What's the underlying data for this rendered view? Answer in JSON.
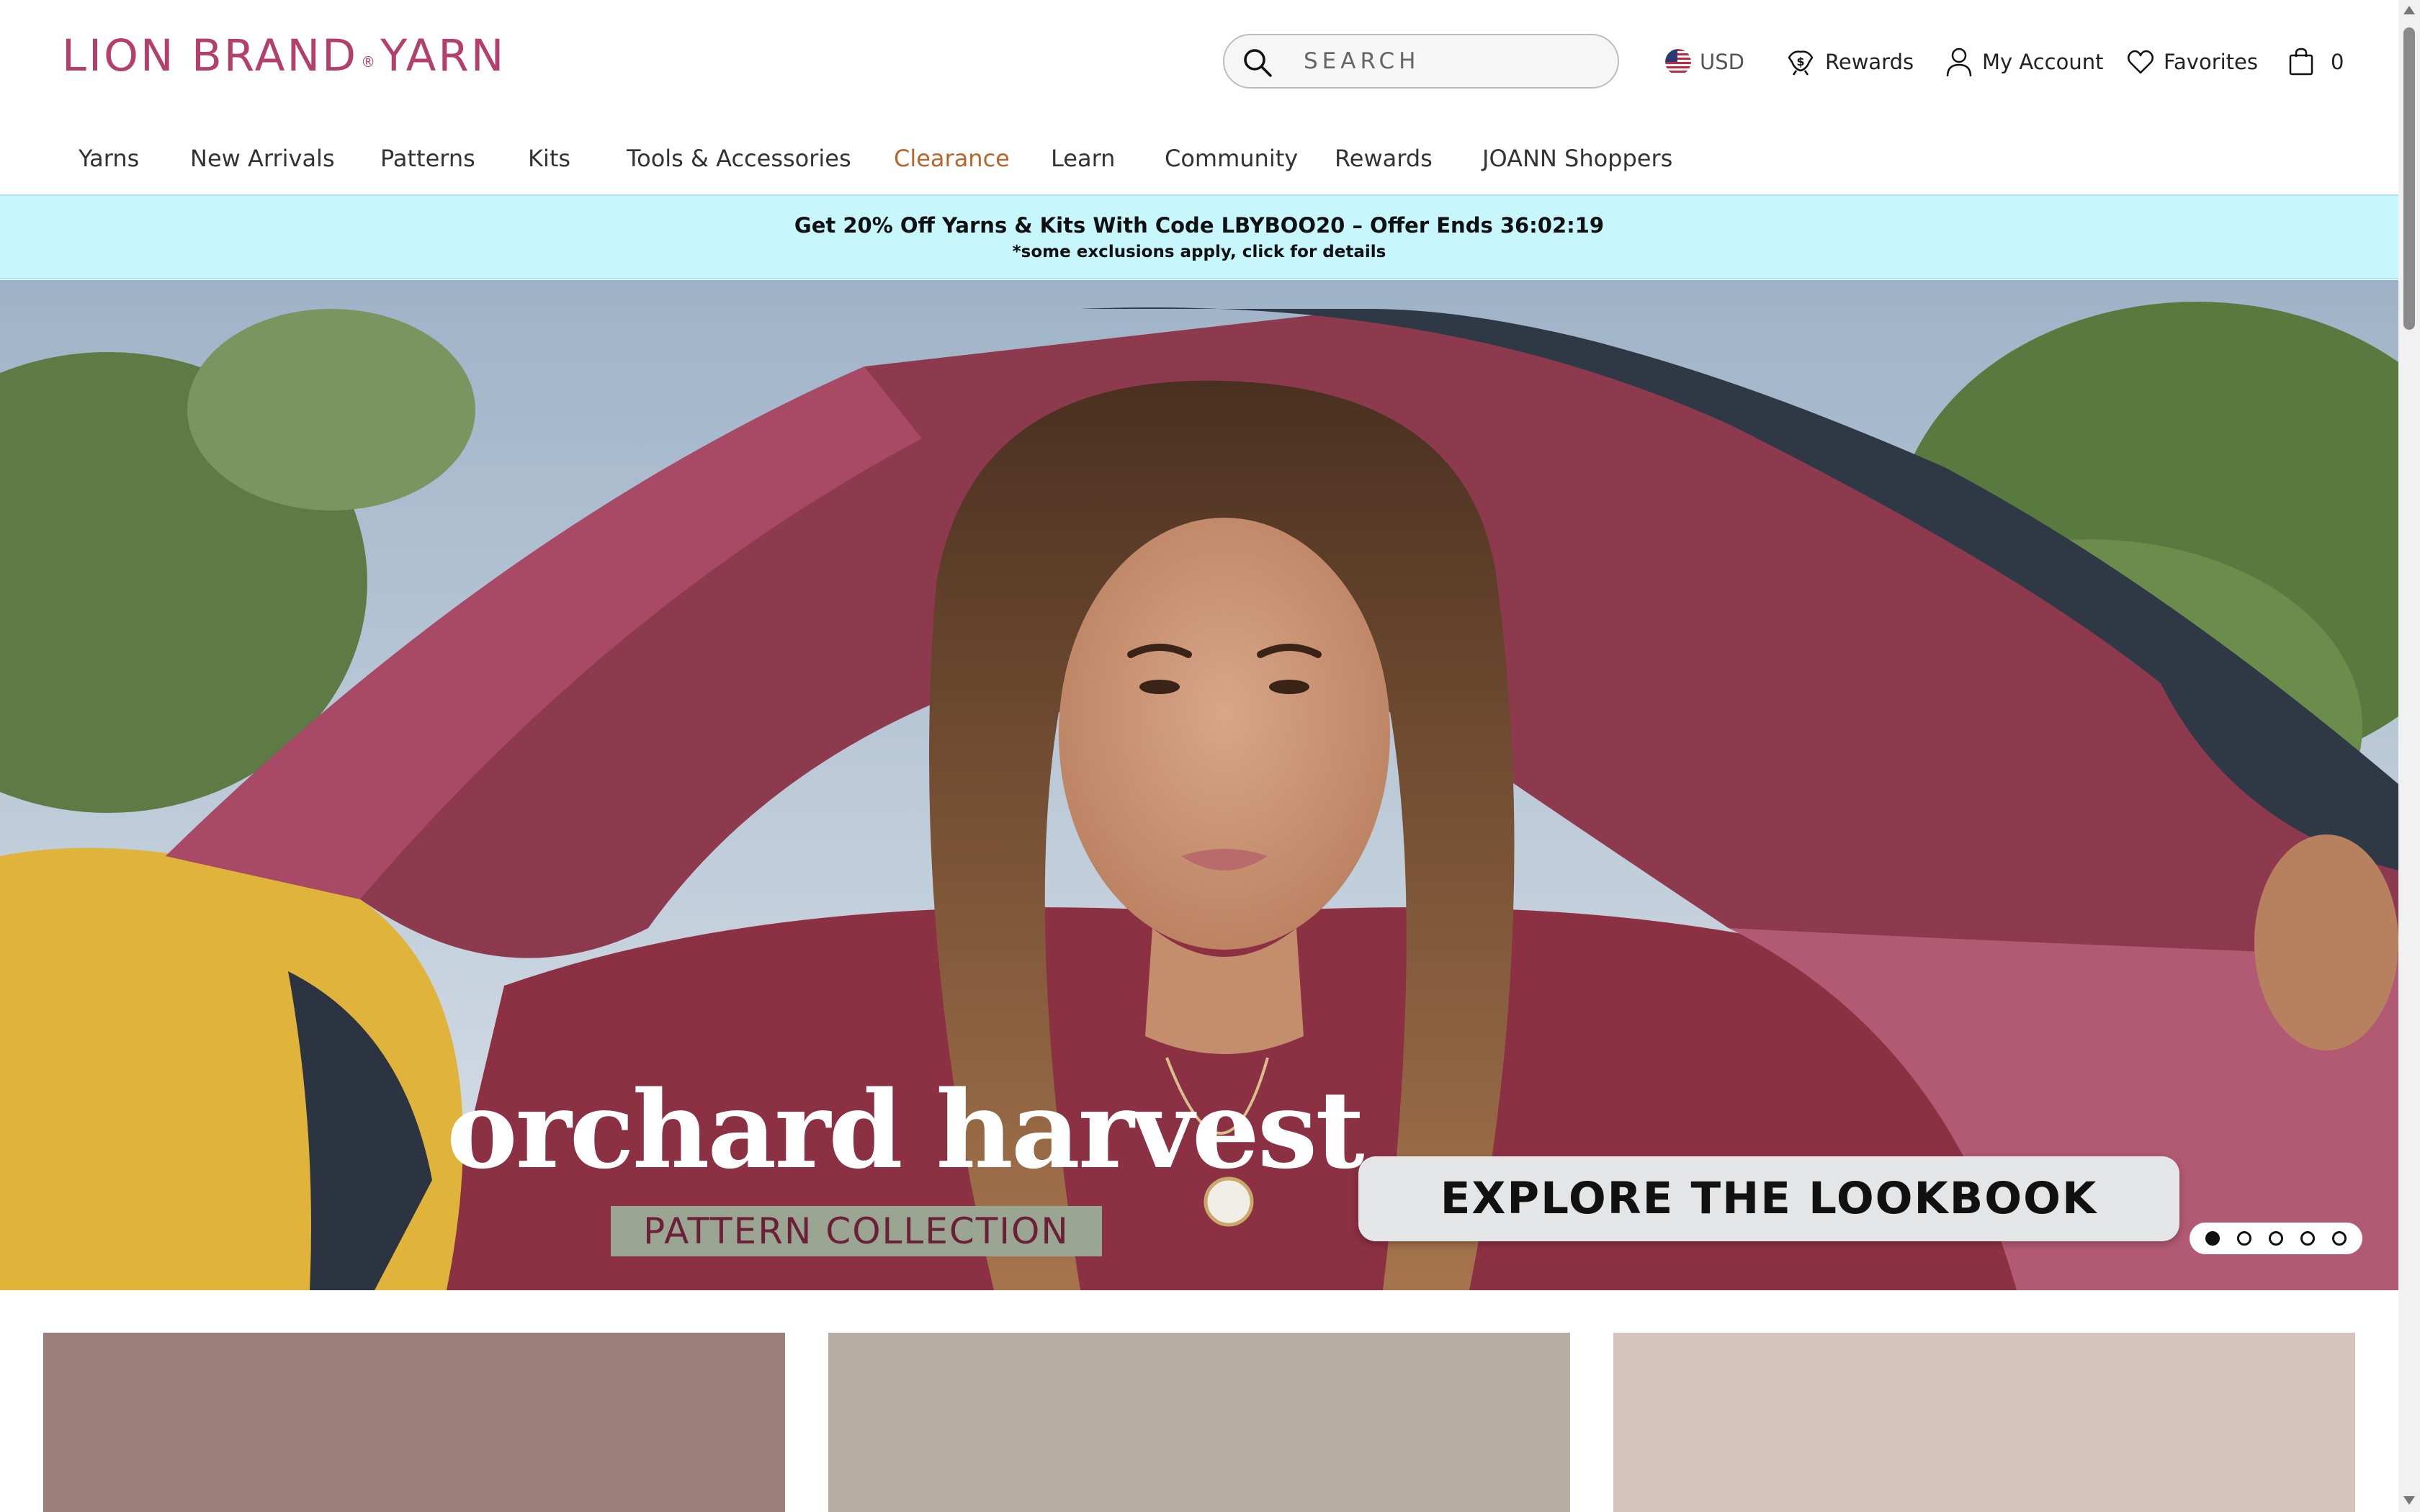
{
  "header": {
    "logo": {
      "part1": "LION BRAND",
      "mark": "®",
      "part2": "YARN"
    },
    "search_placeholder": "SEARCH",
    "currency": "USD",
    "rewards": "Rewards",
    "account": "My Account",
    "favorites": "Favorites",
    "cart_count": "0"
  },
  "nav": {
    "items": [
      "Yarns",
      "New Arrivals",
      "Patterns",
      "Kits",
      "Tools & Accessories",
      "Clearance",
      "Learn",
      "Community",
      "Rewards",
      "JOANN Shoppers"
    ]
  },
  "promo": {
    "main": "Get 20% Off Yarns & Kits With Code LBYBOO20 – Offer Ends 36:02:19",
    "sub": "*some exclusions apply, click for details"
  },
  "hero": {
    "title": "orchard harvest",
    "subtitle": "PATTERN COLLECTION",
    "cta": "EXPLORE THE LOOKBOOK",
    "slide_count": 5,
    "active_slide": 1
  },
  "colors": {
    "brand": "#b43f6c",
    "clearance": "#b8652c",
    "promo_bg": "#c7f6fc",
    "tile_1": "#9d7f79",
    "tile_2": "#b7ada1",
    "tile_3": "#d5c4b9"
  },
  "icons": [
    "search-icon",
    "us-flag-icon",
    "rewards-icon",
    "user-icon",
    "heart-icon",
    "bag-icon"
  ]
}
